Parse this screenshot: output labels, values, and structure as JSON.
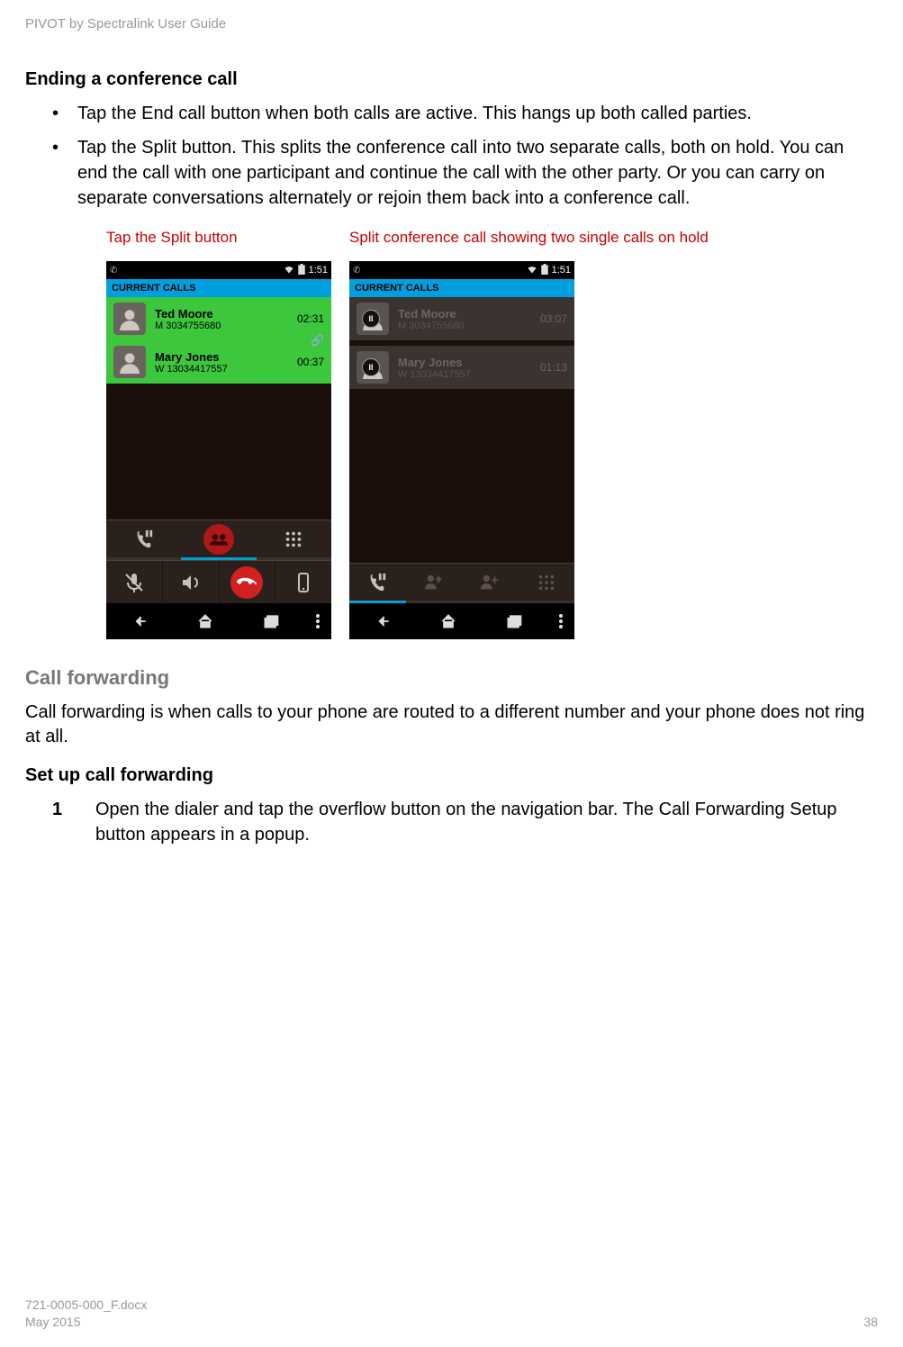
{
  "doc": {
    "header": "PIVOT by Spectralink User Guide",
    "h_ending": "Ending a conference call",
    "bullets": [
      "Tap the End call button when both calls are active. This hangs up both called parties.",
      "Tap the Split button. This splits the conference call into two separate calls, both on hold. You can end the call with one participant and continue the call with the other party. Or you can carry on separate conversations alternately or rejoin them back into a conference call."
    ],
    "cap_left": "Tap the Split button",
    "cap_right": "Split conference call showing two single calls on hold",
    "h_forwarding": "Call forwarding",
    "forwarding_body": "Call forwarding is when calls to your phone are routed to a different number and your phone does not ring at all.",
    "h_setup": "Set up call forwarding",
    "step_num": "1",
    "step_text": "Open the dialer and tap the overflow button on the navigation bar. The Call Forwarding Setup button appears in a popup.",
    "footer_file": "721-0005-000_F.docx",
    "footer_date": "May 2015",
    "footer_page": "38"
  },
  "phone_left": {
    "time": "1:51",
    "header": "CURRENT CALLS",
    "calls": [
      {
        "name": "Ted Moore",
        "number": "M 3034755680",
        "timer": "02:31"
      },
      {
        "name": "Mary Jones",
        "number": "W 13034417557",
        "timer": "00:37"
      }
    ]
  },
  "phone_right": {
    "time": "1:51",
    "header": "CURRENT CALLS",
    "calls": [
      {
        "name": "Ted Moore",
        "number": "M 3034755680",
        "timer": "03:07"
      },
      {
        "name": "Mary Jones",
        "number": "W 13034417557",
        "timer": "01:13"
      }
    ]
  }
}
